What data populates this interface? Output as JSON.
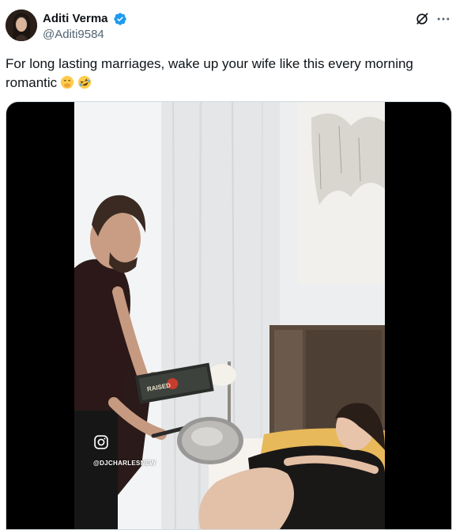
{
  "tweet": {
    "author_name": "Aditi Verma",
    "author_handle": "@Aditi9584",
    "text": "For long lasting marriages, wake up your wife like this every morning\nromantic",
    "emojis": [
      "face-with-hand-over-mouth",
      "rolling-on-floor-laughing"
    ]
  },
  "media": {
    "watermark": "@DJCHARLESNEW",
    "egg_carton_label": "RAISED",
    "watermark_icon": "instagram-icon"
  },
  "icons": {
    "verified": "verified-badge-icon",
    "grok": "grok-icon",
    "more": "more-options-icon"
  },
  "colors": {
    "verified_blue": "#1d9bf0",
    "handle_gray": "#536471"
  }
}
